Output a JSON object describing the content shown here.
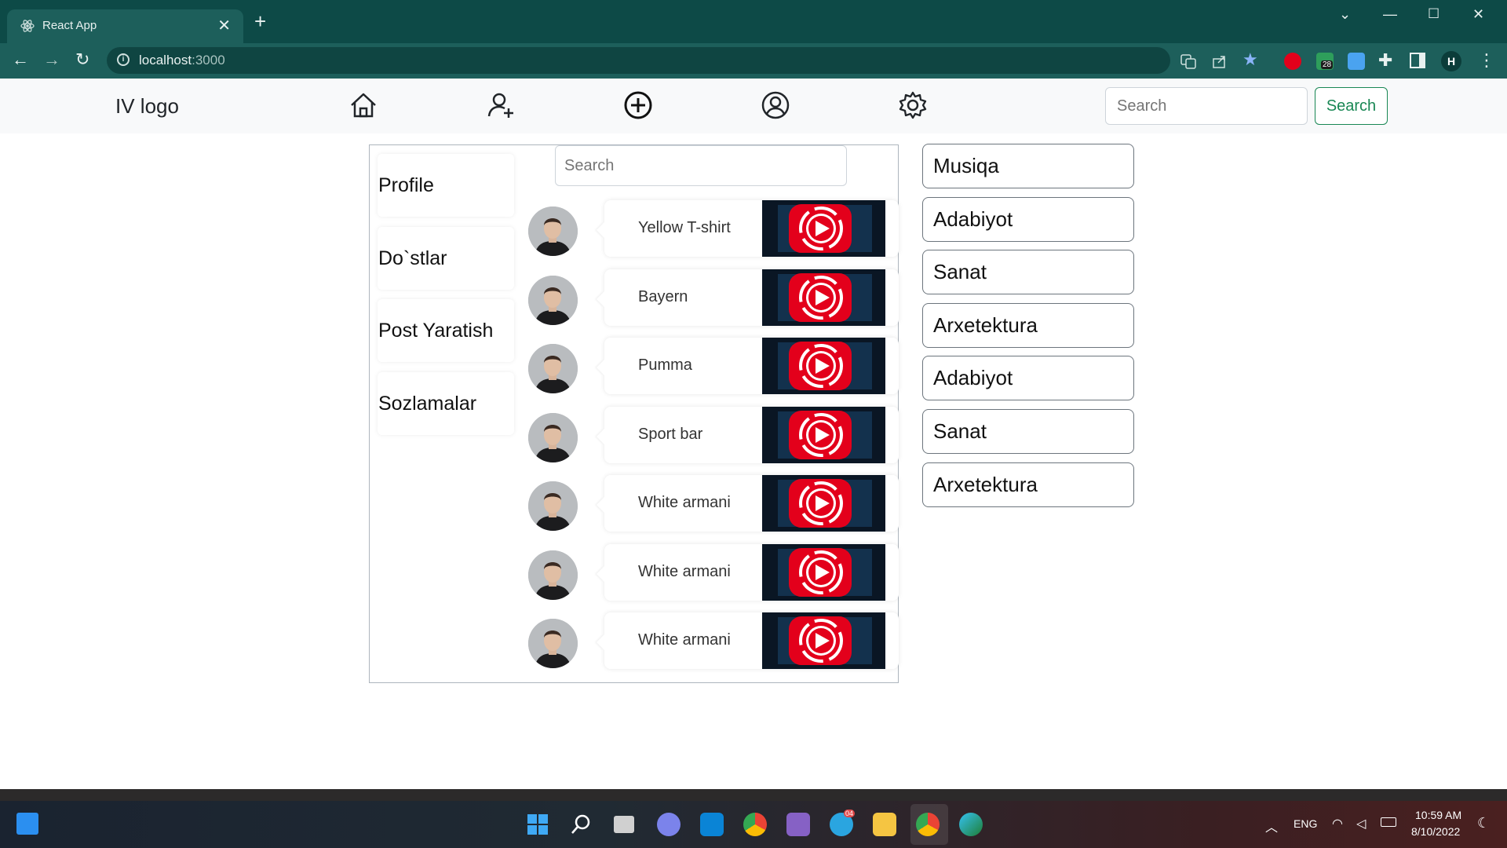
{
  "browser": {
    "tab_title": "React App",
    "url_host": "localhost",
    "url_port": ":3000",
    "profile_initial": "H",
    "ext_badge": "28"
  },
  "navbar": {
    "logo": "IV logo",
    "icons": [
      "home-icon",
      "add-friend-icon",
      "plus-circle-icon",
      "user-circle-icon",
      "gear-icon"
    ],
    "search_placeholder": "Search",
    "search_button": "Search"
  },
  "sidebar": {
    "items": [
      "Profile",
      "Do`stlar",
      "Post Yaratish",
      "Sozlamalar"
    ]
  },
  "feed": {
    "search_placeholder": "Search",
    "posts": [
      {
        "title": "Yellow T-shirt"
      },
      {
        "title": "Bayern"
      },
      {
        "title": "Pumma"
      },
      {
        "title": "Sport bar"
      },
      {
        "title": "White armani"
      },
      {
        "title": "White armani"
      },
      {
        "title": "White armani"
      }
    ]
  },
  "categories": [
    "Musiqa",
    "Adabiyot",
    "Sanat",
    "Arxetektura",
    "Adabiyot",
    "Sanat",
    "Arxetektura"
  ],
  "taskbar": {
    "lang": "ENG",
    "time": "10:59 AM",
    "date": "8/10/2022",
    "telegram_badge": "04"
  },
  "colors": {
    "accent_green": "#198754",
    "chrome_teal": "#1d5f5b",
    "play_red": "#e3001b"
  }
}
